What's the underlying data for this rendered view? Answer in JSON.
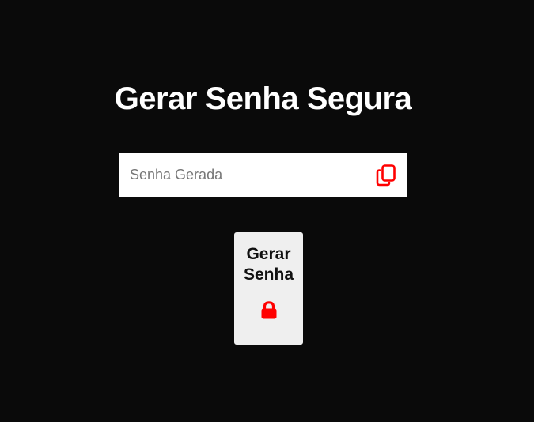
{
  "page": {
    "title": "Gerar Senha Segura"
  },
  "password_field": {
    "value": "",
    "placeholder": "Senha Gerada",
    "copy_icon": "copy-icon"
  },
  "generate_button": {
    "label": "Gerar Senha",
    "icon": "lock-icon"
  },
  "colors": {
    "background": "#0a0a0a",
    "accent": "#ff0000",
    "title_text": "#ffffff",
    "button_bg": "#efefef",
    "field_bg": "#ffffff"
  }
}
